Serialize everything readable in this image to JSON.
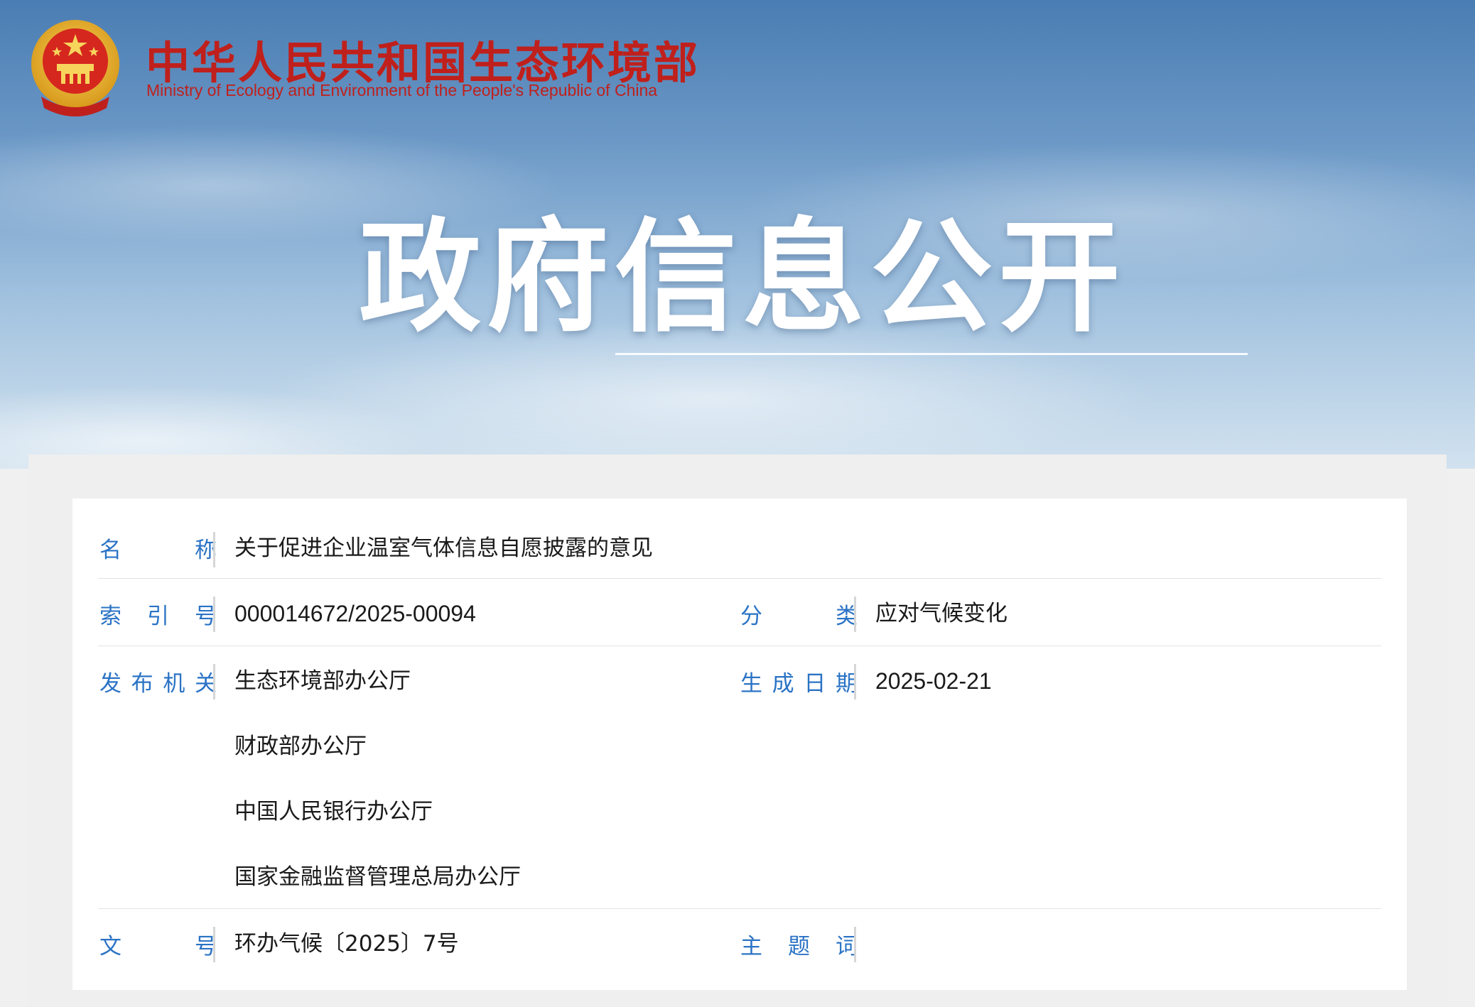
{
  "header": {
    "ministry_name_cn": "中华人民共和国生态环境部",
    "ministry_name_en": "Ministry of Ecology and Environment of the People's Republic of China",
    "emblem_icon": "national-emblem-icon",
    "section_title": "政府信息公开"
  },
  "colors": {
    "brand_red": "#c0201c",
    "label_blue": "#2b73c5",
    "text_dark": "#1a1a1a",
    "banner_blue": "#4a7db3"
  },
  "document": {
    "name_label": "名称",
    "name_value": "关于促进企业温室气体信息自愿披露的意见",
    "index_label": "索引号",
    "index_value": "000014672/2025-00094",
    "category_label": "分类",
    "category_value": "应对气候变化",
    "issuer_label": "发布机关",
    "issuers": [
      "生态环境部办公厅",
      "财政部办公厅",
      "中国人民银行办公厅",
      "国家金融监督管理总局办公厅"
    ],
    "date_label": "生成日期",
    "date_value": "2025-02-21",
    "doc_number_label": "文号",
    "doc_number_value": "环办气候〔2025〕7号",
    "keywords_label": "主题词",
    "keywords_value": ""
  }
}
